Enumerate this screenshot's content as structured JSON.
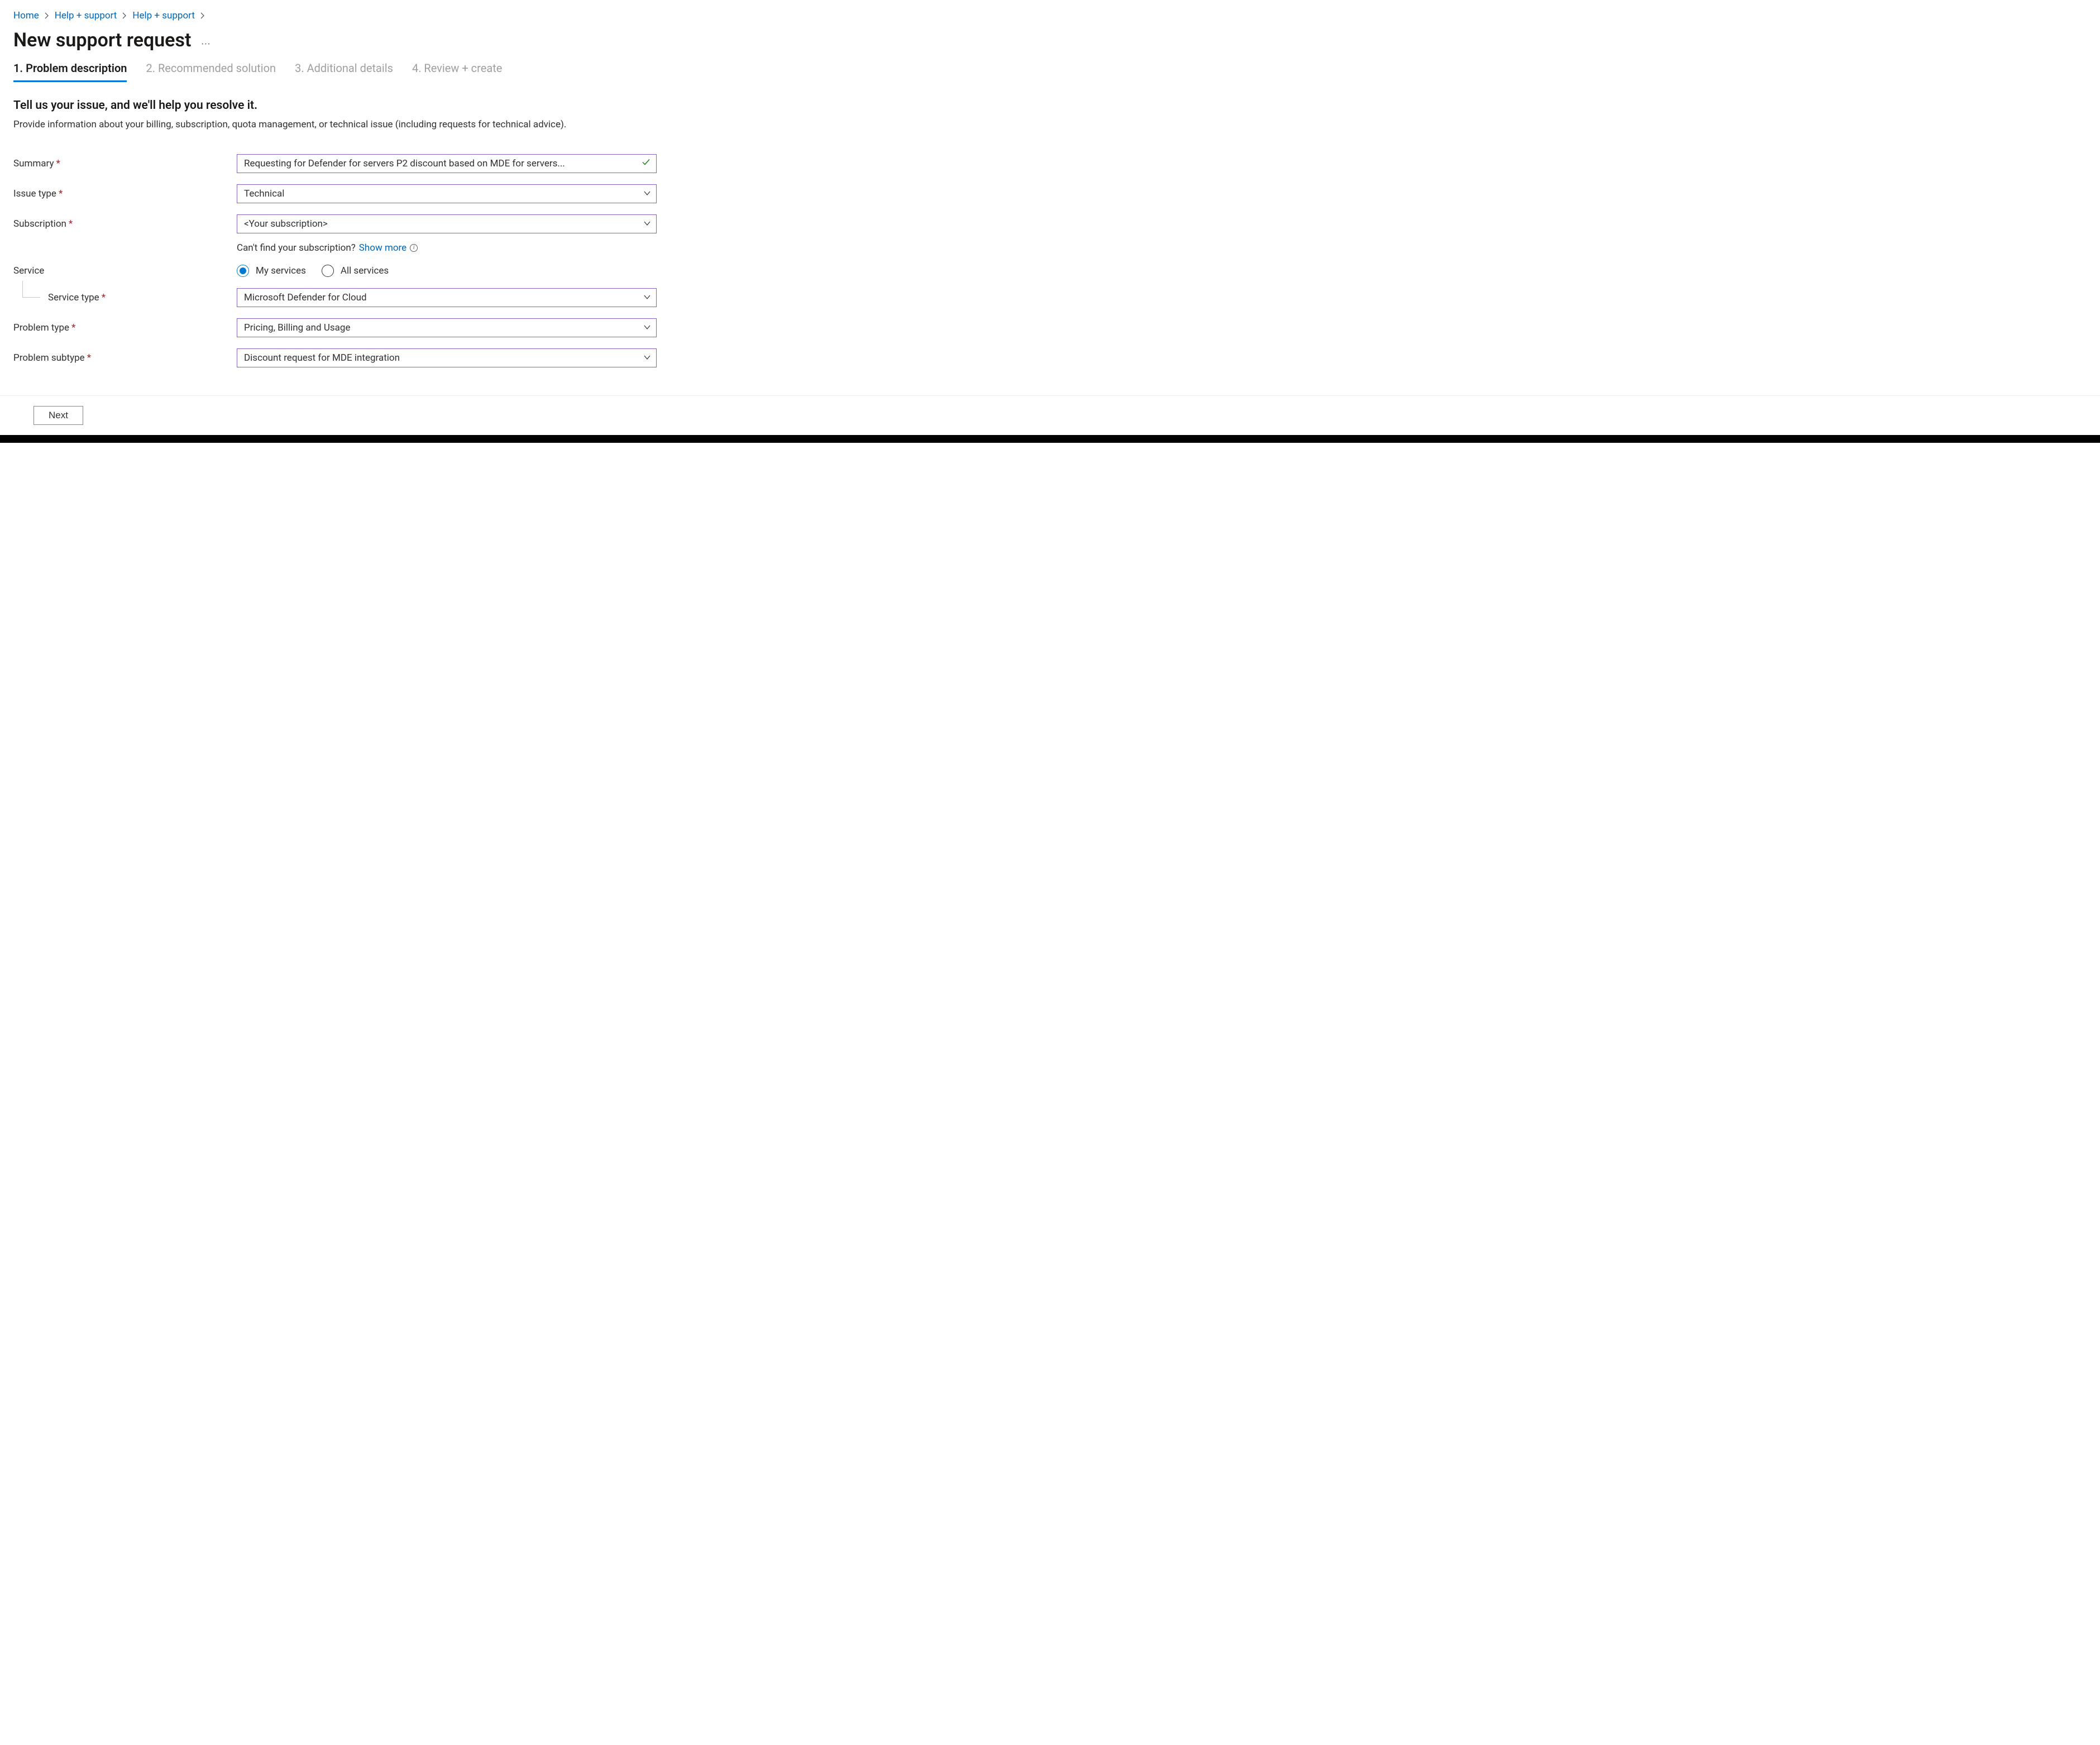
{
  "breadcrumb": {
    "items": [
      "Home",
      "Help + support",
      "Help + support"
    ]
  },
  "page_title": "New support request",
  "tabs": {
    "t1": "1. Problem description",
    "t2": "2. Recommended solution",
    "t3": "3. Additional details",
    "t4": "4. Review + create"
  },
  "section": {
    "heading": "Tell us your issue, and we'll help you resolve it.",
    "description": "Provide information about your billing, subscription, quota management, or technical issue (including requests for technical advice)."
  },
  "form": {
    "summary": {
      "label": "Summary",
      "value": "Requesting for Defender for servers P2 discount based on MDE for servers..."
    },
    "issue_type": {
      "label": "Issue type",
      "value": "Technical"
    },
    "subscription": {
      "label": "Subscription",
      "value": "<Your subscription>"
    },
    "subscription_hint": {
      "text": "Can't find your subscription?",
      "link": "Show more"
    },
    "service": {
      "label": "Service",
      "option1": "My services",
      "option2": "All services"
    },
    "service_type": {
      "label": "Service type",
      "value": "Microsoft Defender for Cloud"
    },
    "problem_type": {
      "label": "Problem type",
      "value": "Pricing, Billing and Usage"
    },
    "problem_subtype": {
      "label": "Problem subtype",
      "value": "Discount request for MDE integration"
    }
  },
  "footer": {
    "next": "Next"
  }
}
